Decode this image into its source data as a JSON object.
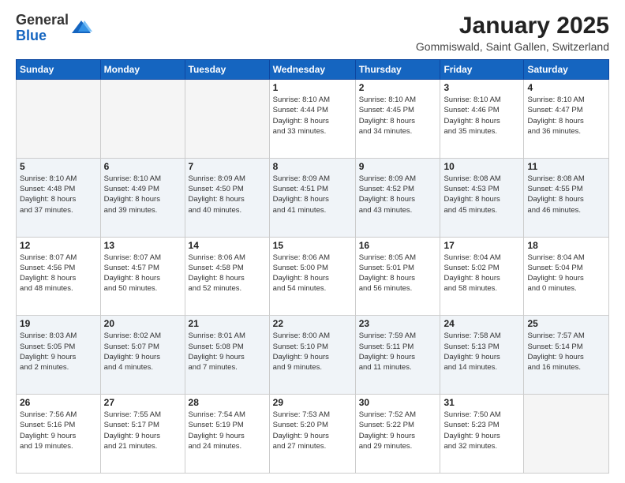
{
  "header": {
    "logo_general": "General",
    "logo_blue": "Blue",
    "month_title": "January 2025",
    "location": "Gommiswald, Saint Gallen, Switzerland"
  },
  "weekdays": [
    "Sunday",
    "Monday",
    "Tuesday",
    "Wednesday",
    "Thursday",
    "Friday",
    "Saturday"
  ],
  "weeks": [
    [
      {
        "day": "",
        "info": ""
      },
      {
        "day": "",
        "info": ""
      },
      {
        "day": "",
        "info": ""
      },
      {
        "day": "1",
        "info": "Sunrise: 8:10 AM\nSunset: 4:44 PM\nDaylight: 8 hours\nand 33 minutes."
      },
      {
        "day": "2",
        "info": "Sunrise: 8:10 AM\nSunset: 4:45 PM\nDaylight: 8 hours\nand 34 minutes."
      },
      {
        "day": "3",
        "info": "Sunrise: 8:10 AM\nSunset: 4:46 PM\nDaylight: 8 hours\nand 35 minutes."
      },
      {
        "day": "4",
        "info": "Sunrise: 8:10 AM\nSunset: 4:47 PM\nDaylight: 8 hours\nand 36 minutes."
      }
    ],
    [
      {
        "day": "5",
        "info": "Sunrise: 8:10 AM\nSunset: 4:48 PM\nDaylight: 8 hours\nand 37 minutes."
      },
      {
        "day": "6",
        "info": "Sunrise: 8:10 AM\nSunset: 4:49 PM\nDaylight: 8 hours\nand 39 minutes."
      },
      {
        "day": "7",
        "info": "Sunrise: 8:09 AM\nSunset: 4:50 PM\nDaylight: 8 hours\nand 40 minutes."
      },
      {
        "day": "8",
        "info": "Sunrise: 8:09 AM\nSunset: 4:51 PM\nDaylight: 8 hours\nand 41 minutes."
      },
      {
        "day": "9",
        "info": "Sunrise: 8:09 AM\nSunset: 4:52 PM\nDaylight: 8 hours\nand 43 minutes."
      },
      {
        "day": "10",
        "info": "Sunrise: 8:08 AM\nSunset: 4:53 PM\nDaylight: 8 hours\nand 45 minutes."
      },
      {
        "day": "11",
        "info": "Sunrise: 8:08 AM\nSunset: 4:55 PM\nDaylight: 8 hours\nand 46 minutes."
      }
    ],
    [
      {
        "day": "12",
        "info": "Sunrise: 8:07 AM\nSunset: 4:56 PM\nDaylight: 8 hours\nand 48 minutes."
      },
      {
        "day": "13",
        "info": "Sunrise: 8:07 AM\nSunset: 4:57 PM\nDaylight: 8 hours\nand 50 minutes."
      },
      {
        "day": "14",
        "info": "Sunrise: 8:06 AM\nSunset: 4:58 PM\nDaylight: 8 hours\nand 52 minutes."
      },
      {
        "day": "15",
        "info": "Sunrise: 8:06 AM\nSunset: 5:00 PM\nDaylight: 8 hours\nand 54 minutes."
      },
      {
        "day": "16",
        "info": "Sunrise: 8:05 AM\nSunset: 5:01 PM\nDaylight: 8 hours\nand 56 minutes."
      },
      {
        "day": "17",
        "info": "Sunrise: 8:04 AM\nSunset: 5:02 PM\nDaylight: 8 hours\nand 58 minutes."
      },
      {
        "day": "18",
        "info": "Sunrise: 8:04 AM\nSunset: 5:04 PM\nDaylight: 9 hours\nand 0 minutes."
      }
    ],
    [
      {
        "day": "19",
        "info": "Sunrise: 8:03 AM\nSunset: 5:05 PM\nDaylight: 9 hours\nand 2 minutes."
      },
      {
        "day": "20",
        "info": "Sunrise: 8:02 AM\nSunset: 5:07 PM\nDaylight: 9 hours\nand 4 minutes."
      },
      {
        "day": "21",
        "info": "Sunrise: 8:01 AM\nSunset: 5:08 PM\nDaylight: 9 hours\nand 7 minutes."
      },
      {
        "day": "22",
        "info": "Sunrise: 8:00 AM\nSunset: 5:10 PM\nDaylight: 9 hours\nand 9 minutes."
      },
      {
        "day": "23",
        "info": "Sunrise: 7:59 AM\nSunset: 5:11 PM\nDaylight: 9 hours\nand 11 minutes."
      },
      {
        "day": "24",
        "info": "Sunrise: 7:58 AM\nSunset: 5:13 PM\nDaylight: 9 hours\nand 14 minutes."
      },
      {
        "day": "25",
        "info": "Sunrise: 7:57 AM\nSunset: 5:14 PM\nDaylight: 9 hours\nand 16 minutes."
      }
    ],
    [
      {
        "day": "26",
        "info": "Sunrise: 7:56 AM\nSunset: 5:16 PM\nDaylight: 9 hours\nand 19 minutes."
      },
      {
        "day": "27",
        "info": "Sunrise: 7:55 AM\nSunset: 5:17 PM\nDaylight: 9 hours\nand 21 minutes."
      },
      {
        "day": "28",
        "info": "Sunrise: 7:54 AM\nSunset: 5:19 PM\nDaylight: 9 hours\nand 24 minutes."
      },
      {
        "day": "29",
        "info": "Sunrise: 7:53 AM\nSunset: 5:20 PM\nDaylight: 9 hours\nand 27 minutes."
      },
      {
        "day": "30",
        "info": "Sunrise: 7:52 AM\nSunset: 5:22 PM\nDaylight: 9 hours\nand 29 minutes."
      },
      {
        "day": "31",
        "info": "Sunrise: 7:50 AM\nSunset: 5:23 PM\nDaylight: 9 hours\nand 32 minutes."
      },
      {
        "day": "",
        "info": ""
      }
    ]
  ]
}
